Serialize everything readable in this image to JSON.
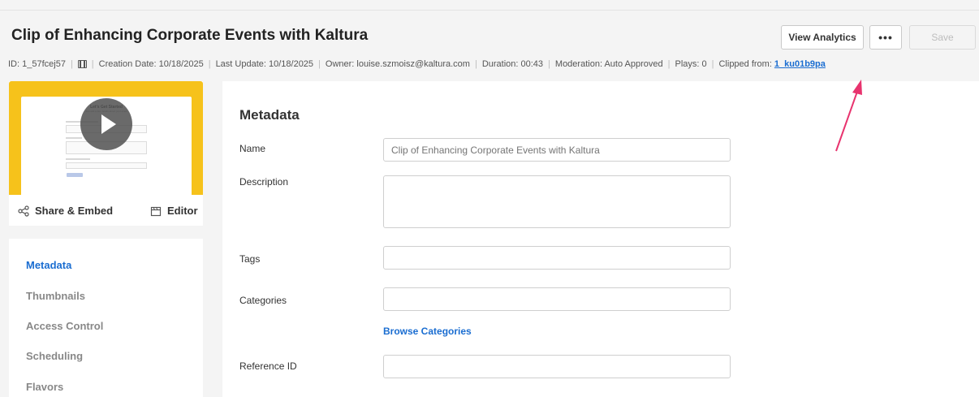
{
  "header": {
    "title": "Clip of Enhancing Corporate Events with Kaltura",
    "buttons": {
      "view_analytics": "View Analytics",
      "more": "•••",
      "save": "Save"
    }
  },
  "meta": {
    "id": "ID: 1_57fcej57",
    "creation_date": "Creation Date: 10/18/2025",
    "last_update": "Last Update: 10/18/2025",
    "owner": "Owner: louise.szmoisz@kaltura.com",
    "duration": "Duration: 00:43",
    "moderation": "Moderation: Auto Approved",
    "plays": "Plays: 0",
    "clipped_from_label": "Clipped from:",
    "clipped_from_id": "1_ku01b9pa",
    "separator": "|"
  },
  "thumbnail": {
    "title": "Let's Get Started",
    "subtitle": "Just add a few details about your event"
  },
  "player_actions": {
    "share_embed": "Share & Embed",
    "editor": "Editor"
  },
  "sidebar": {
    "items": [
      {
        "label": "Metadata",
        "active": true
      },
      {
        "label": "Thumbnails",
        "active": false
      },
      {
        "label": "Access Control",
        "active": false
      },
      {
        "label": "Scheduling",
        "active": false
      },
      {
        "label": "Flavors",
        "active": false
      }
    ]
  },
  "form": {
    "section_title": "Metadata",
    "name_label": "Name",
    "name_placeholder": "Clip of Enhancing Corporate Events with Kaltura",
    "description_label": "Description",
    "tags_label": "Tags",
    "categories_label": "Categories",
    "browse_categories": "Browse Categories",
    "reference_id_label": "Reference ID"
  },
  "colors": {
    "accent": "#1a6dd1",
    "annotation_arrow": "#e8336e",
    "thumbnail_frame": "#f6c21b"
  }
}
